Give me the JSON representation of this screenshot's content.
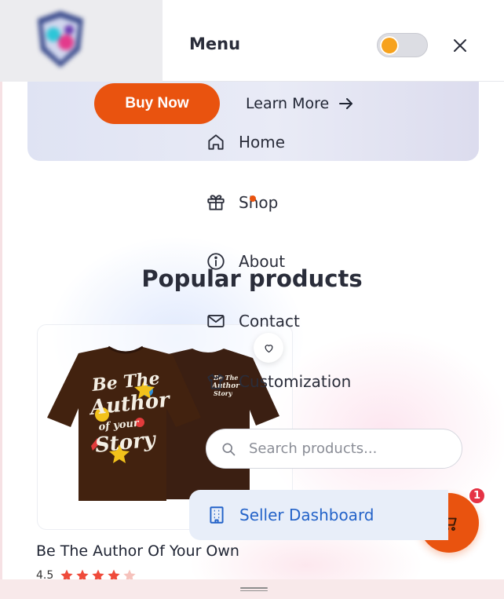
{
  "colors": {
    "accent": "#e9530f",
    "badge": "#e53345",
    "seller_text": "#2463c9",
    "star": "#ef4a3a"
  },
  "hero": {
    "buy_label": "Buy Now",
    "learn_label": "Learn More",
    "learn_icon": "arrow-right-icon"
  },
  "section": {
    "title": "Popular products"
  },
  "product": {
    "name": "Be The Author Of Your Own",
    "rating": "4.5",
    "rating_value": 4.5,
    "rating_max": 5,
    "image_text": "Be The Author of Your Story",
    "wishlist_icon": "heart-icon"
  },
  "cart": {
    "count": "1",
    "icon": "cart-icon"
  },
  "menu": {
    "title": "Menu",
    "theme_icon": "sun-icon",
    "close_icon": "close-icon",
    "items": [
      {
        "label": "Home",
        "icon": "home-icon"
      },
      {
        "label": "Shop",
        "icon": "gift-icon"
      },
      {
        "label": "About",
        "icon": "info-icon"
      },
      {
        "label": "Contact",
        "icon": "mail-icon"
      },
      {
        "label": "Customization",
        "icon": "shirt-icon"
      }
    ],
    "search": {
      "placeholder": "Search products...",
      "value": "",
      "icon": "search-icon"
    },
    "seller": {
      "label": "Seller Dashboard",
      "icon": "building-icon"
    }
  }
}
